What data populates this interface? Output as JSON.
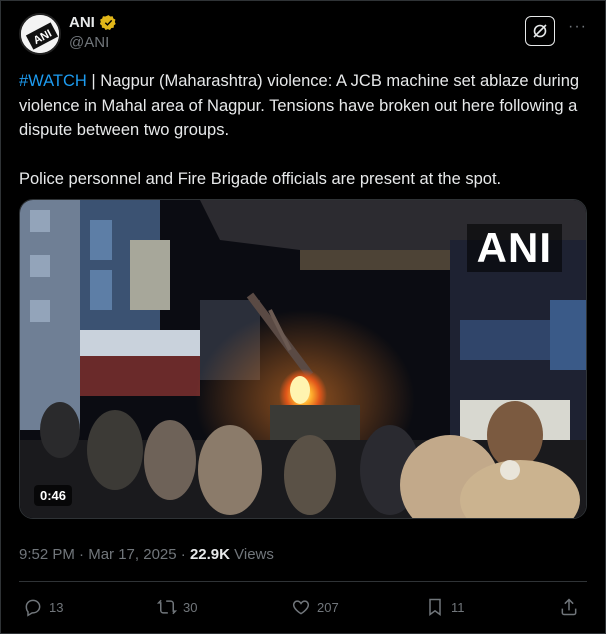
{
  "author": {
    "name": "ANI",
    "handle": "@ANI",
    "avatar_text": "ANI",
    "verified_color": "#e2b719"
  },
  "tweet": {
    "hashtag": "#WATCH",
    "text_line1": " | Nagpur (Maharashtra) violence: A JCB machine set ablaze during violence in Mahal area of Nagpur. Tensions have broken out here following a dispute between two groups.",
    "text_line2": "Police personnel and Fire Brigade officials are present at the spot."
  },
  "media": {
    "watermark": "ANI",
    "duration": "0:46"
  },
  "meta": {
    "time": "9:52 PM",
    "separator": " · ",
    "date": "Mar 17, 2025",
    "views_count": "22.9K",
    "views_label": " Views"
  },
  "actions": {
    "replies": "13",
    "reposts": "30",
    "likes": "207",
    "bookmarks": "11"
  },
  "colors": {
    "background": "#000000",
    "text": "#e7e9ea",
    "muted": "#71767b",
    "link": "#1d9bf0",
    "border": "#2f3336"
  },
  "icons": [
    "verified-badge-icon",
    "grok-icon",
    "more-icon",
    "reply-icon",
    "repost-icon",
    "like-icon",
    "bookmark-icon",
    "share-icon"
  ]
}
